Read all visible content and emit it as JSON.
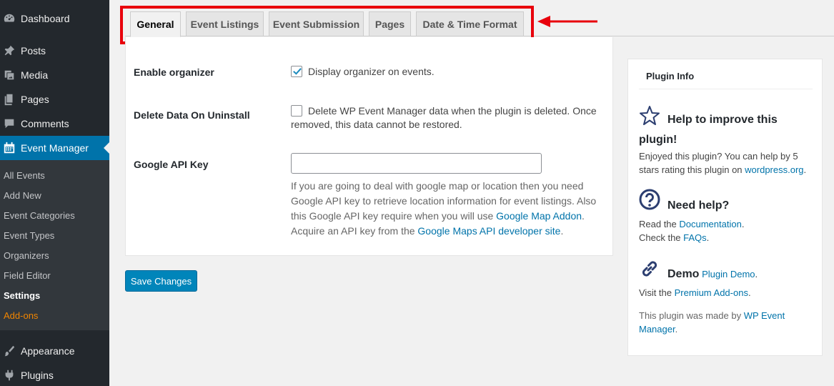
{
  "sidebar": {
    "menu": [
      {
        "label": "Dashboard",
        "icon": "dashboard-icon"
      },
      {
        "label": "Posts",
        "icon": "pin-icon"
      },
      {
        "label": "Media",
        "icon": "media-icon"
      },
      {
        "label": "Pages",
        "icon": "pages-icon"
      },
      {
        "label": "Comments",
        "icon": "comment-icon"
      },
      {
        "label": "Event Manager",
        "icon": "calendar-icon"
      }
    ],
    "submenu": [
      "All Events",
      "Add New",
      "Event Categories",
      "Event Types",
      "Organizers",
      "Field Editor",
      "Settings",
      "Add-ons"
    ],
    "bottom_menu": [
      {
        "label": "Appearance",
        "icon": "brush-icon"
      },
      {
        "label": "Plugins",
        "icon": "plug-icon"
      }
    ]
  },
  "tabs": [
    "General",
    "Event Listings",
    "Event Submission",
    "Pages",
    "Date & Time Format"
  ],
  "active_tab": "General",
  "settings": {
    "organizer": {
      "label": "Enable organizer",
      "checkbox_text": "Display organizer on events.",
      "checked": true
    },
    "delete_data": {
      "label": "Delete Data On Uninstall",
      "checkbox_line1": "Delete WP Event Manager data when the plugin is deleted. Once",
      "checkbox_line2": "removed, this data cannot be restored.",
      "checked": false
    },
    "api_key": {
      "label": "Google API Key",
      "value": "",
      "help_line1": "If you are going to deal with google map or location then you need",
      "help_line2": "Google API key to retrieve location information for event listings. Also",
      "help_line3_pre": "this Google API key require when you will use ",
      "help_line3_link": "Google Map Addon",
      "help_line3_post": ".",
      "help_line4_pre": "Acquire an API key from the ",
      "help_line4_link": "Google Maps API developer site",
      "help_line4_post": "."
    },
    "save_label": "Save Changes"
  },
  "info_box": {
    "title": "Plugin Info",
    "improve": {
      "heading_line1": "Help to improve this",
      "heading_line2": "plugin!",
      "text_line1": "Enjoyed this plugin? You can help by 5",
      "text_line2_pre": "stars rating this plugin on ",
      "text_line2_link": "wordpress.org",
      "text_line2_post": "."
    },
    "help": {
      "heading": "Need help?",
      "line1_pre": "Read the ",
      "line1_link": "Documentation",
      "line1_post": ".",
      "line2_pre": "Check the ",
      "line2_link": "FAQs",
      "line2_post": "."
    },
    "demo": {
      "heading": "Demo",
      "heading_link": "Plugin Demo",
      "heading_post": ".",
      "line_pre": "Visit the ",
      "line_link": "Premium Add-ons",
      "line_post": "."
    },
    "made_by": {
      "line1_pre": "This plugin was made by ",
      "line1_link": "WP Event",
      "line2_link": "Manager",
      "line2_post": "."
    }
  },
  "colors": {
    "admin_accent": "#0073aa",
    "highlight_annotation": "#e8000c",
    "addons_orange": "#f18500"
  }
}
